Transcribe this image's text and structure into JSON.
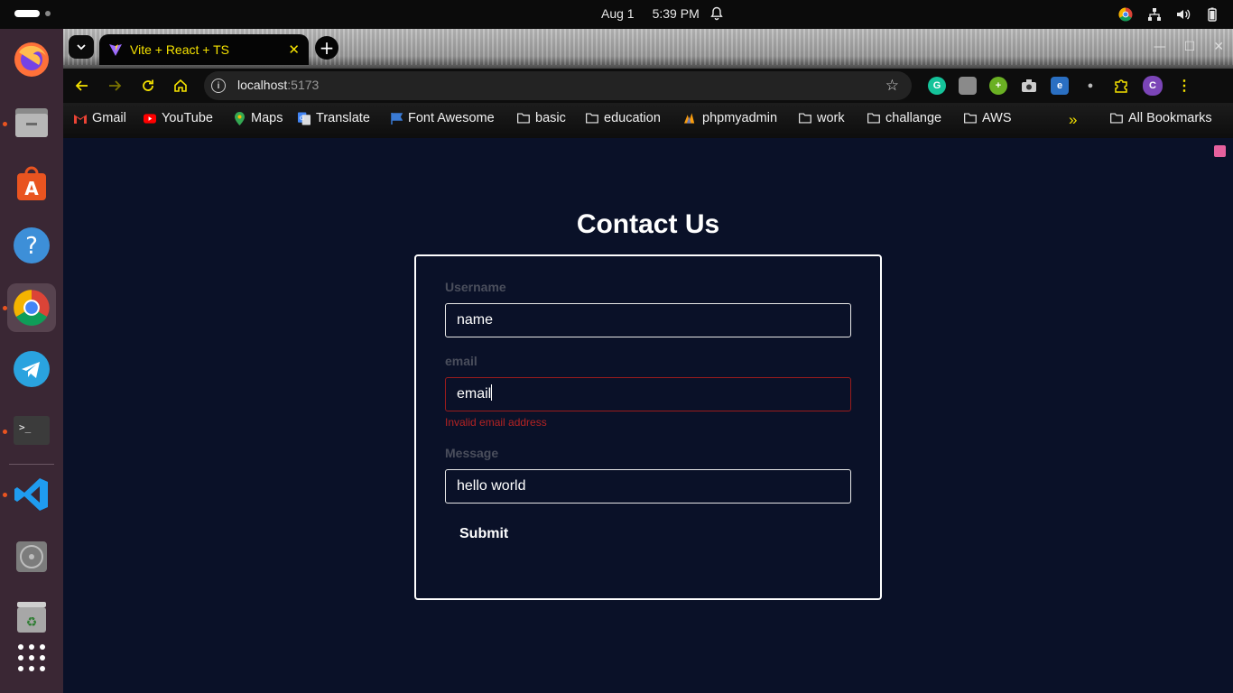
{
  "system_bar": {
    "date": "Aug 1",
    "time": "5:39 PM"
  },
  "dock": {
    "apps": [
      "firefox-icon",
      "files-icon",
      "app-center-icon",
      "help-icon",
      "chrome-icon",
      "telegram-icon",
      "terminal-icon",
      "vscode-icon",
      "disc-icon",
      "trash-icon",
      "app-grid-icon"
    ]
  },
  "browser": {
    "tab": {
      "title": "Vite + React + TS",
      "close": "✕"
    },
    "new_tab": "+",
    "url": {
      "host": "localhost",
      "port": ":5173"
    },
    "profile_initial": "C",
    "bookmarks": [
      {
        "label": "Gmail",
        "icon": "gmail-icon"
      },
      {
        "label": "YouTube",
        "icon": "youtube-icon"
      },
      {
        "label": "Maps",
        "icon": "maps-icon"
      },
      {
        "label": "Translate",
        "icon": "translate-icon"
      },
      {
        "label": "Font Awesome",
        "icon": "font-awesome-icon"
      },
      {
        "label": "basic",
        "icon": "folder-icon"
      },
      {
        "label": "education",
        "icon": "folder-icon"
      },
      {
        "label": "phpmyadmin",
        "icon": "phpmyadmin-icon"
      },
      {
        "label": "work",
        "icon": "folder-icon"
      },
      {
        "label": "challange",
        "icon": "folder-icon"
      },
      {
        "label": "AWS",
        "icon": "folder-icon"
      }
    ],
    "bookmarks_overflow": "»",
    "all_bookmarks": "All Bookmarks"
  },
  "form": {
    "title": "Contact Us",
    "username": {
      "label": "Username",
      "value": "name"
    },
    "email": {
      "label": "email",
      "value": "email",
      "error": "Invalid email address"
    },
    "message": {
      "label": "Message",
      "value": "hello world"
    },
    "submit_label": "Submit"
  },
  "colors": {
    "page_background": "#0a1128",
    "error": "#b42323",
    "tab_text": "#f5e200",
    "dock_background": "#3a2734"
  }
}
